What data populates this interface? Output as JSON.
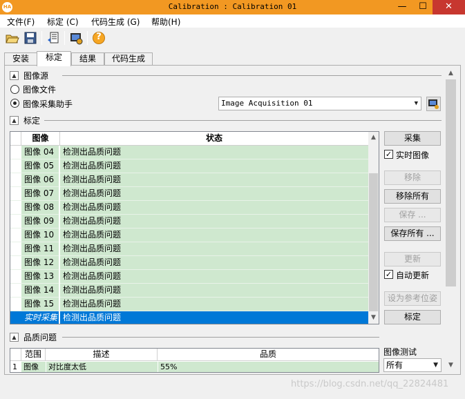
{
  "window": {
    "title": "Calibration : Calibration 01",
    "app_icon": "HA",
    "minimize": "—",
    "maximize": "☐",
    "close": "✕"
  },
  "menu": [
    {
      "label": "文件(F)"
    },
    {
      "label": "标定 (C)"
    },
    {
      "label": "代码生成 (G)"
    },
    {
      "label": "帮助(H)"
    }
  ],
  "toolbar": {
    "icons": [
      "open-folder-icon",
      "save-disk-icon",
      "export-code-icon",
      "image-acquisition-icon",
      "help-icon"
    ],
    "help_glyph": "?"
  },
  "tabs": [
    {
      "label": "安装"
    },
    {
      "label": "标定",
      "active": true
    },
    {
      "label": "结果"
    },
    {
      "label": "代码生成"
    }
  ],
  "image_source": {
    "section_label": "图像源",
    "option_file": "图像文件",
    "option_assistant": "图像采集助手",
    "selected": "图像采集助手",
    "assistant_combo_value": "Image Acquisition 01"
  },
  "calibration": {
    "section_label": "标定",
    "columns": [
      "图像",
      "状态"
    ],
    "rows": [
      {
        "name": "图像 04",
        "state": "检测出品质问题"
      },
      {
        "name": "图像 05",
        "state": "检测出品质问题"
      },
      {
        "name": "图像 06",
        "state": "检测出品质问题"
      },
      {
        "name": "图像 07",
        "state": "检测出品质问题"
      },
      {
        "name": "图像 08",
        "state": "检测出品质问题"
      },
      {
        "name": "图像 09",
        "state": "检测出品质问题"
      },
      {
        "name": "图像 10",
        "state": "检测出品质问题"
      },
      {
        "name": "图像 11",
        "state": "检测出品质问题"
      },
      {
        "name": "图像 12",
        "state": "检测出品质问题"
      },
      {
        "name": "图像 13",
        "state": "检测出品质问题"
      },
      {
        "name": "图像 14",
        "state": "检测出品质问题"
      },
      {
        "name": "图像 15",
        "state": "检测出品质问题"
      },
      {
        "name": "实时采集",
        "state": "检测出品质问题",
        "selected": true
      }
    ],
    "buttons": {
      "acquire": "采集",
      "live_image": "实时图像",
      "remove": "移除",
      "remove_all": "移除所有",
      "save": "保存 ...",
      "save_all": "保存所有 ...",
      "update": "更新",
      "auto_update": "自动更新",
      "set_reference_pose": "设为参考位姿",
      "calibrate": "标定"
    },
    "live_image_checked": true,
    "auto_update_checked": true
  },
  "quality": {
    "section_label": "品质问题",
    "columns": [
      "范围",
      "描述",
      "品质"
    ],
    "rows": [
      {
        "index": "1",
        "scope": "图像",
        "description": "对比度太低",
        "quality": "55%"
      }
    ],
    "image_test_label": "图像测试",
    "image_test_value": "所有"
  },
  "watermark": "https://blog.csdn.net/qq_22824481",
  "colors": {
    "titlebar": "#f29822",
    "row_green": "#cfe8cf",
    "selection": "#0078d7",
    "close": "#c7372f"
  }
}
